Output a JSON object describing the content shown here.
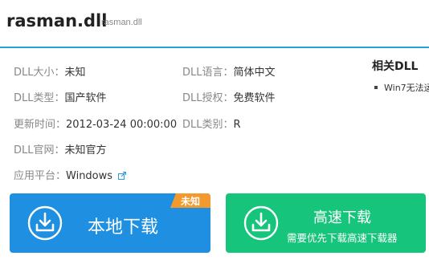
{
  "header": {
    "title": "rasman.dll",
    "subtitle": "rasman.dll"
  },
  "info": {
    "size": {
      "label": "DLL大小：",
      "value": "未知"
    },
    "language": {
      "label": "DLL语言：",
      "value": "简体中文"
    },
    "type": {
      "label": "DLL类型：",
      "value": "国产软件"
    },
    "license": {
      "label": "DLL授权：",
      "value": "免费软件"
    },
    "updated": {
      "label": "更新时间：",
      "value": "2012-03-24 00:00:00"
    },
    "category": {
      "label": "DLL类别：",
      "value": "R"
    },
    "website": {
      "label": "DLL官网：",
      "value": "未知官方"
    },
    "platform": {
      "label": "应用平台：",
      "value": "Windows"
    }
  },
  "related": {
    "title": "相关DLL",
    "items": [
      "Win7无法运"
    ]
  },
  "buttons": {
    "local": {
      "label": "本地下载",
      "badge": "未知"
    },
    "fast": {
      "label": "高速下载",
      "sublabel": "需要优先下载高速下载器"
    }
  },
  "colors": {
    "blue": "#1e8fe1",
    "green": "#17c47b",
    "orange": "#f39a2f",
    "header_line": "#2a9de0"
  },
  "icons": {
    "download": "download-tray-icon",
    "external": "external-link-icon"
  }
}
